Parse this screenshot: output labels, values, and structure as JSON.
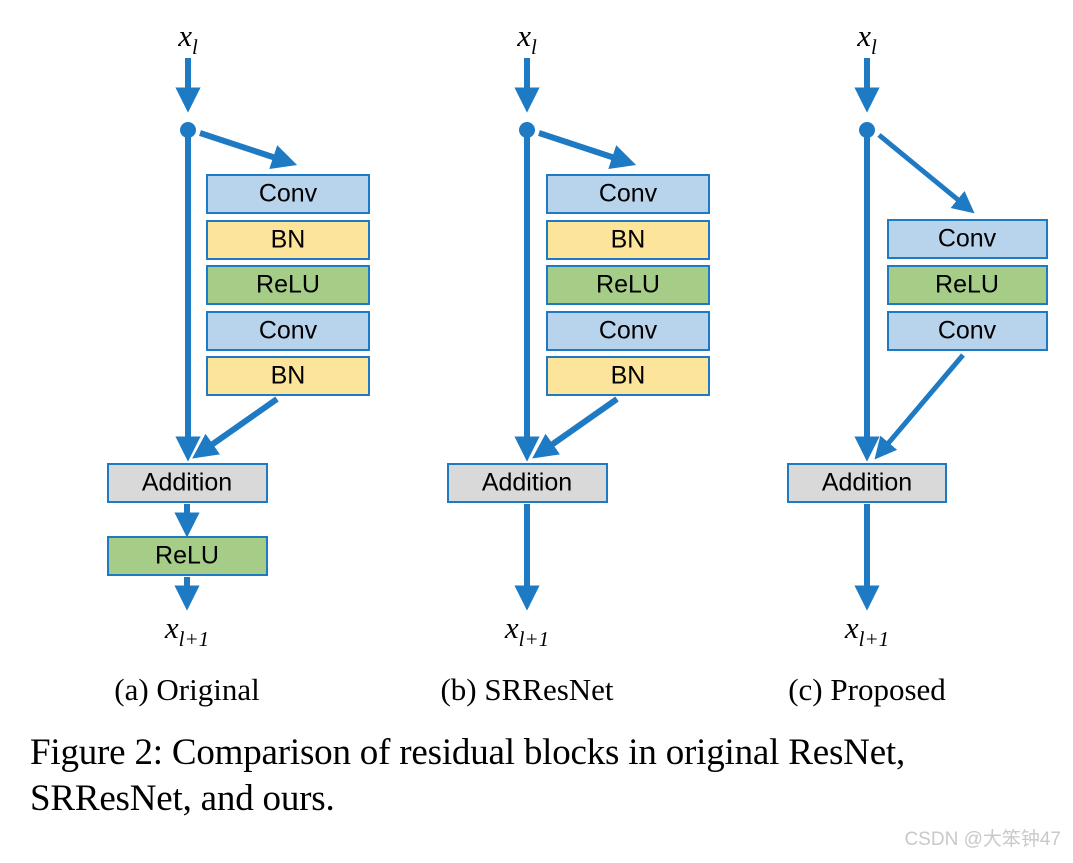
{
  "figure": {
    "caption": "Figure 2: Comparison of residual blocks in original ResNet, SRResNet, and ours.",
    "watermark": "CSDN @大笨钟47",
    "input_label": "x",
    "input_sub": "l",
    "output_label": "x",
    "output_sub": "l+1"
  },
  "colors": {
    "arrow_blue": "#1f7ac4",
    "box_border": "#1f7ac4",
    "conv_fill": "#b8d3ec",
    "bn_fill": "#fce49a",
    "relu_fill": "#a5cd87",
    "addition_fill": "#d9d9d9",
    "background": "#ffffff",
    "text": "#000000",
    "watermark": "#c9c9c9"
  },
  "chart_data": {
    "type": "diagram",
    "title": "Comparison of residual blocks in original ResNet, SRResNet, and ours.",
    "columns": [
      {
        "id": "a",
        "caption": "(a) Original",
        "input": "x_l",
        "output": "x_l+1",
        "branch_blocks": [
          "Conv",
          "BN",
          "ReLU",
          "Conv",
          "BN"
        ],
        "merge_block": "Addition",
        "post_merge_blocks": [
          "ReLU"
        ],
        "has_skip_connection": true
      },
      {
        "id": "b",
        "caption": "(b) SRResNet",
        "input": "x_l",
        "output": "x_l+1",
        "branch_blocks": [
          "Conv",
          "BN",
          "ReLU",
          "Conv",
          "BN"
        ],
        "merge_block": "Addition",
        "post_merge_blocks": [],
        "has_skip_connection": true
      },
      {
        "id": "c",
        "caption": "(c) Proposed",
        "input": "x_l",
        "output": "x_l+1",
        "branch_blocks": [
          "Conv",
          "ReLU",
          "Conv"
        ],
        "merge_block": "Addition",
        "post_merge_blocks": [],
        "has_skip_connection": true
      }
    ]
  },
  "columns": [
    {
      "caption": "(a) Original",
      "blocks": [
        {
          "label": "Conv",
          "kind": "conv"
        },
        {
          "label": "BN",
          "kind": "bn"
        },
        {
          "label": "ReLU",
          "kind": "relu"
        },
        {
          "label": "Conv",
          "kind": "conv"
        },
        {
          "label": "BN",
          "kind": "bn"
        }
      ],
      "addition": "Addition",
      "after": [
        {
          "label": "ReLU",
          "kind": "relu"
        }
      ]
    },
    {
      "caption": "(b) SRResNet",
      "blocks": [
        {
          "label": "Conv",
          "kind": "conv"
        },
        {
          "label": "BN",
          "kind": "bn"
        },
        {
          "label": "ReLU",
          "kind": "relu"
        },
        {
          "label": "Conv",
          "kind": "conv"
        },
        {
          "label": "BN",
          "kind": "bn"
        }
      ],
      "addition": "Addition",
      "after": []
    },
    {
      "caption": "(c) Proposed",
      "blocks": [
        {
          "label": "Conv",
          "kind": "conv"
        },
        {
          "label": "ReLU",
          "kind": "relu"
        },
        {
          "label": "Conv",
          "kind": "conv"
        }
      ],
      "addition": "Addition",
      "after": []
    }
  ]
}
